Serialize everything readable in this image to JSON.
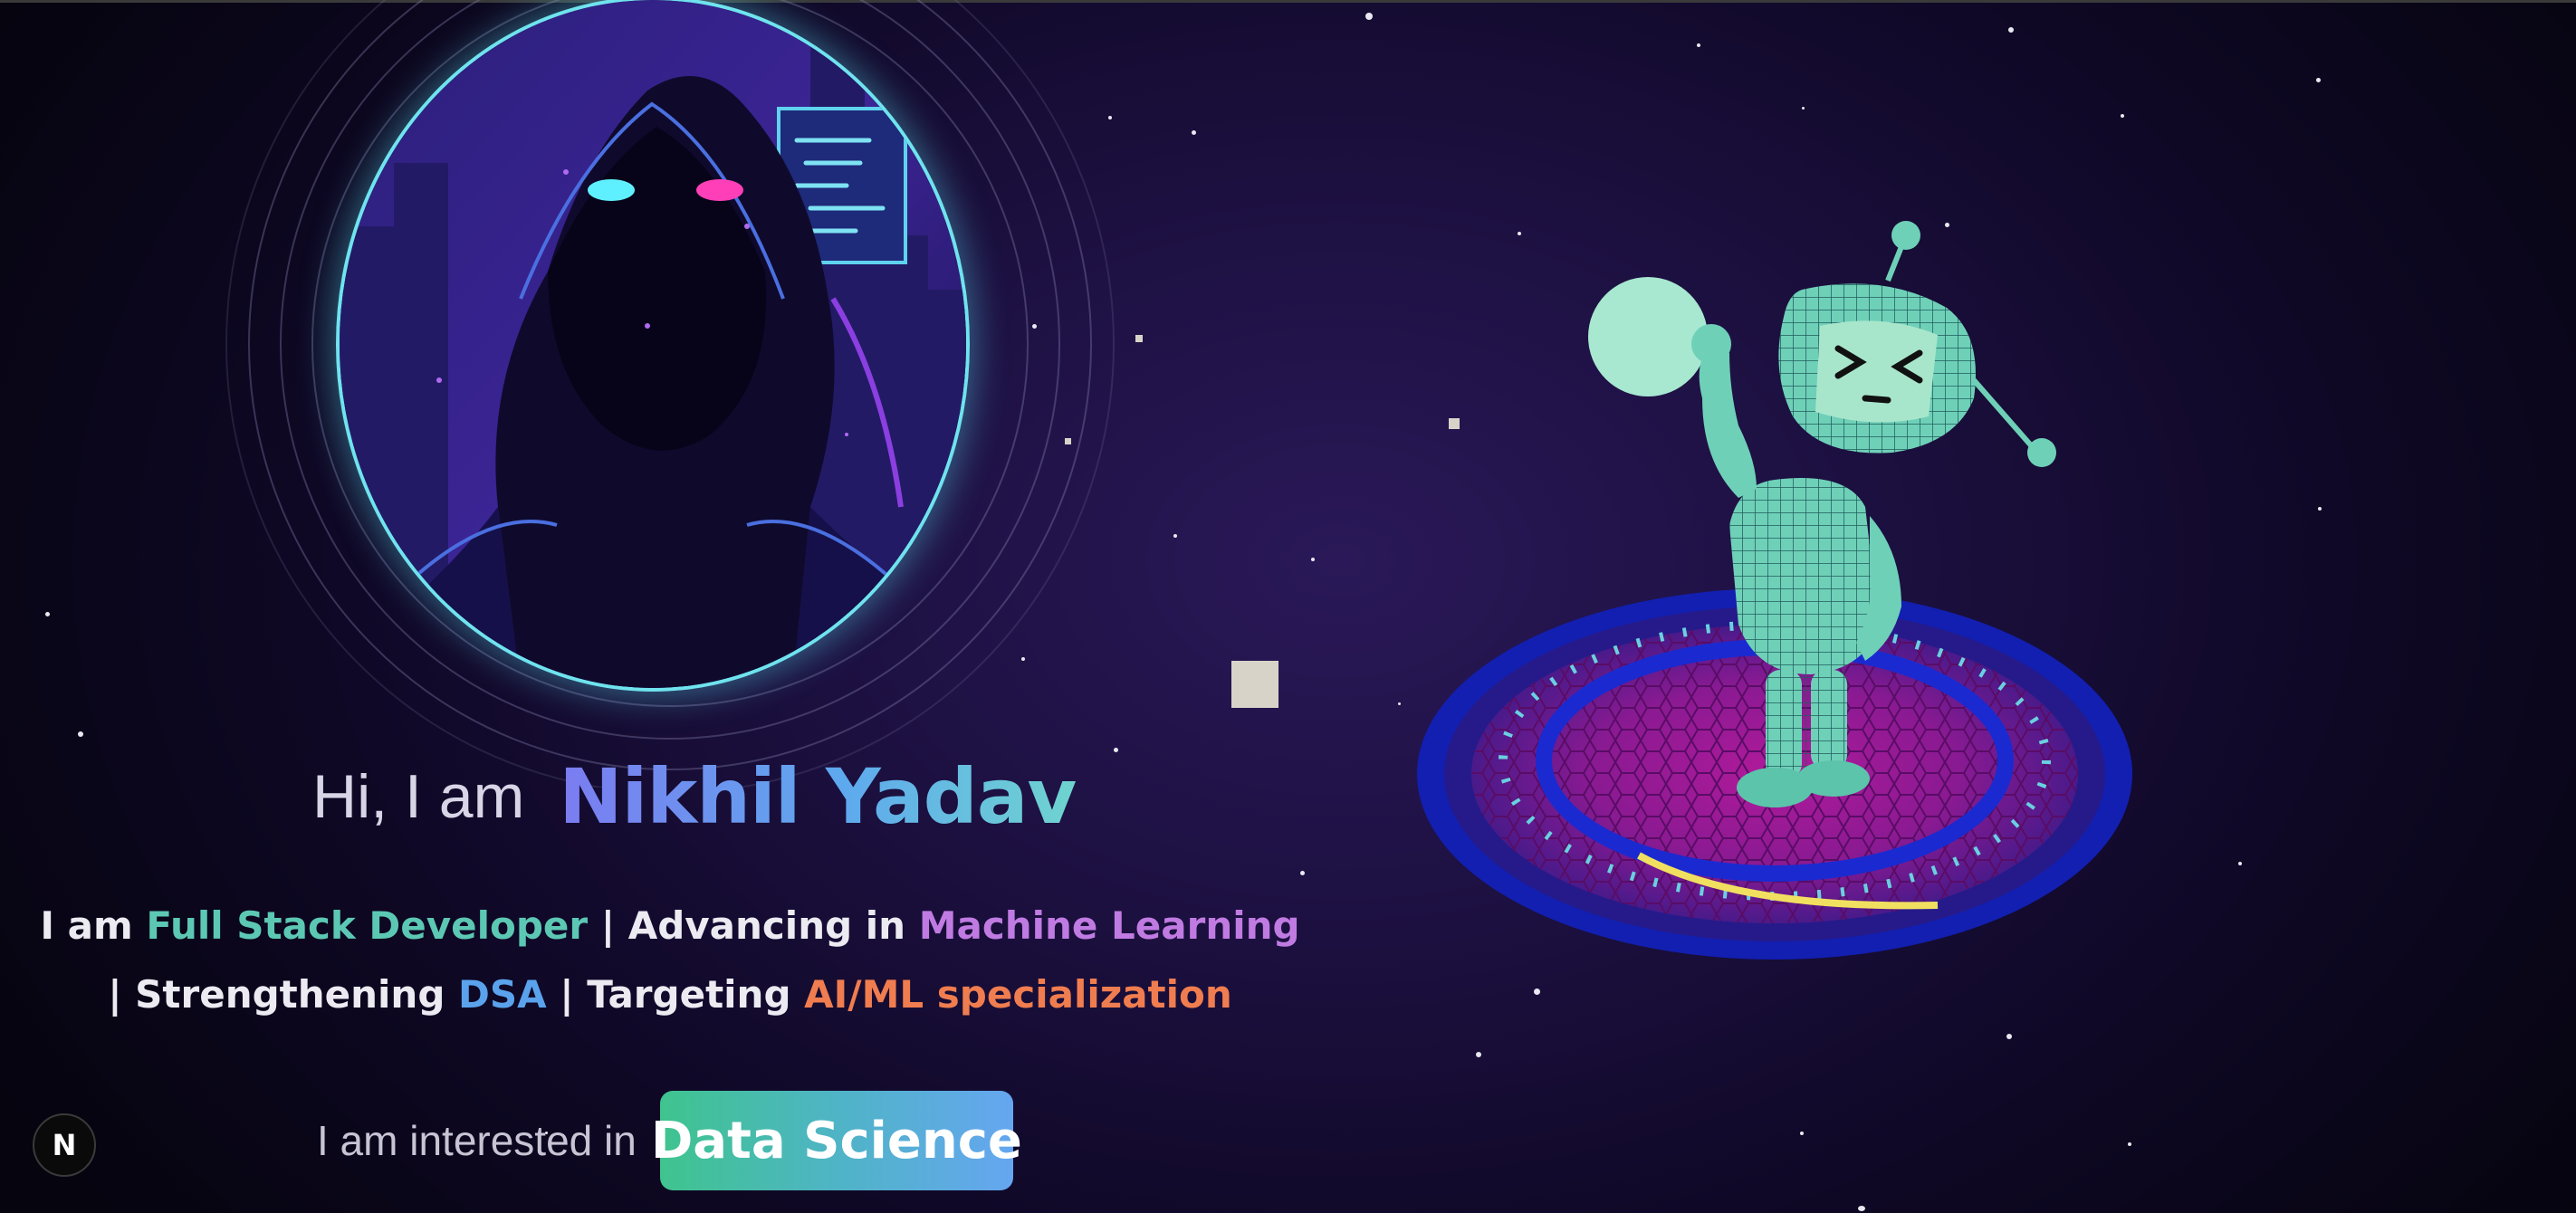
{
  "hero": {
    "greeting": "Hi, I am",
    "name": "Nikhil Yadav",
    "tagline": {
      "part1_prefix": "I am ",
      "skill1": "Full Stack Developer",
      "part1_mid": " | Advancing in ",
      "skill2": "Machine Learning",
      "part2_prefix": "| Strengthening ",
      "skill3": "DSA",
      "part2_mid": " | Targeting ",
      "skill4": "AI/ML specialization"
    },
    "interest_label": "I am interested in",
    "interest_value": "Data Science"
  },
  "badge": {
    "letter": "N"
  },
  "icons": {
    "avatar": "hooded-hacker-illustration",
    "robot": "3d-robot-on-platform",
    "badge": "nextjs-logo-icon"
  },
  "colors": {
    "background": "#1c1040",
    "ring": "#6fe3ee",
    "accent_teal": "#5cc8b4",
    "accent_violet": "#c07be2",
    "accent_blue": "#5aa2ec",
    "accent_orange": "#f07d4f"
  }
}
